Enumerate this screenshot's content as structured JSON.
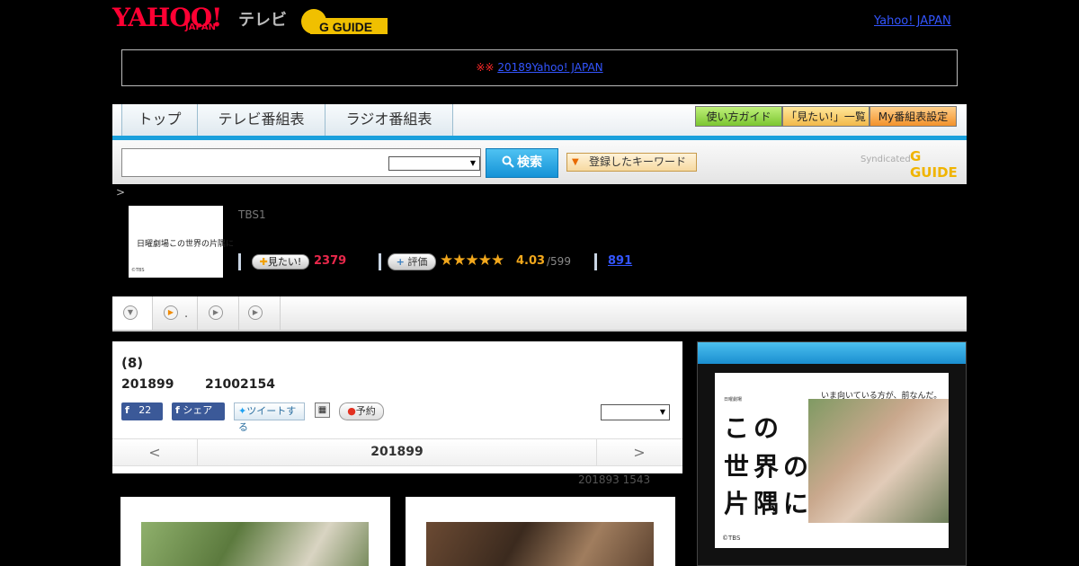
{
  "header": {
    "logo_yahoo": "YAHOO!",
    "logo_japan": "JAPAN",
    "logo_tv": "テレビ",
    "logo_gguide": "G GUIDE",
    "top_link": "Yahoo! JAPAN"
  },
  "notice": {
    "marks": "※※",
    "link": "20189Yahoo! JAPAN"
  },
  "nav": {
    "tabs": [
      "トップ",
      "テレビ番組表",
      "ラジオ番組表"
    ],
    "links": [
      "使い方ガイド",
      "「見たい!」一覧",
      "My番組表設定"
    ]
  },
  "search": {
    "button": "検索",
    "keyword_button": "登録したキーワード",
    "syndicated": "Syndicated",
    "syndicated_logo": "G GUIDE",
    "search_icon": "magnifier-icon"
  },
  "breadcrumb": ">",
  "program": {
    "thumb_title": "日曜劇場この世界の片隅に",
    "thumb_copyright": "©TBS",
    "channel": "TBS1",
    "mitai_label": "見たい!",
    "mitai_count": "2379",
    "hyoka_label": "評価",
    "stars": "★★★★★",
    "rating": "4.03",
    "rating_count": "/599",
    "link_count": "891"
  },
  "toolbar": {
    "item2_label": "."
  },
  "main": {
    "title": "(8)",
    "date": "201899",
    "time": "21002154",
    "fb_like_count": "22",
    "fb_share": "シェア",
    "tweet": "ツイートする",
    "reserve": "予約",
    "pager_prev": "<",
    "pager_next": ">",
    "pager_date": "201899",
    "updated": "201893  1543"
  },
  "side": {
    "ad_tag": "いま向いている方が、前なんだ。",
    "ad_small": "日曜劇場",
    "ad_line1": "この",
    "ad_line2": "世界の",
    "ad_line3": "片隅に",
    "ad_copyright": "©TBS"
  },
  "colors": {
    "accent_blue": "#1aa0dc",
    "brand_red": "#ff0033",
    "mitai_red": "#e8284b",
    "star_orange": "#f3a81c",
    "link_blue": "#3355ff"
  }
}
